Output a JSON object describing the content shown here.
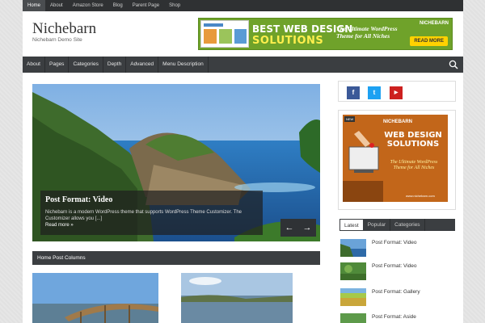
{
  "topnav": {
    "items": [
      "Home",
      "About",
      "Amazon Store",
      "Blog",
      "Parent Page",
      "Shop"
    ]
  },
  "site": {
    "title": "Nichebarn",
    "description": "Nichebarn Demo Site"
  },
  "banner": {
    "line1": "BEST WEB DESIGN",
    "line2": "SOLUTIONS",
    "tagline1": "The Ultimate WordPress",
    "tagline2": "Theme for All Niches",
    "brand": "NICHEBARN",
    "cta": "READ MORE"
  },
  "mainnav": {
    "items": [
      "About",
      "Pages",
      "Categories",
      "Depth",
      "Advanced",
      "Menu Description"
    ]
  },
  "slider": {
    "title": "Post Format: Video",
    "excerpt": "Nichebarn is a modern WordPress theme that supports WordPress Theme Customizer. The Customizer allows you [...]",
    "read_more": "Read more »",
    "prev": "←",
    "next": "→"
  },
  "section": {
    "title": "Home Post Columns"
  },
  "social": {
    "facebook": "f",
    "twitter": "t",
    "youtube": "▶"
  },
  "ad": {
    "brand": "NICHEBARN",
    "new": "NEW",
    "headline": "WEB DESIGN SOLUTIONS",
    "tagline": "The Ultimate WordPress Theme for All Niches",
    "url": "www.nichebarn.com"
  },
  "sidebar_tabs": {
    "items": [
      "Latest",
      "Popular",
      "Categories"
    ],
    "active": "Latest"
  },
  "sidebar_posts": [
    {
      "title": "Post Format: Video"
    },
    {
      "title": "Post Format: Video"
    },
    {
      "title": "Post Format: Gallery"
    },
    {
      "title": "Post Format: Aside"
    }
  ],
  "colors": {
    "dark_nav": "#3b3e41",
    "topbar": "#2f3133",
    "banner_green": "#6fa22a",
    "ad_orange": "#c2661a"
  }
}
